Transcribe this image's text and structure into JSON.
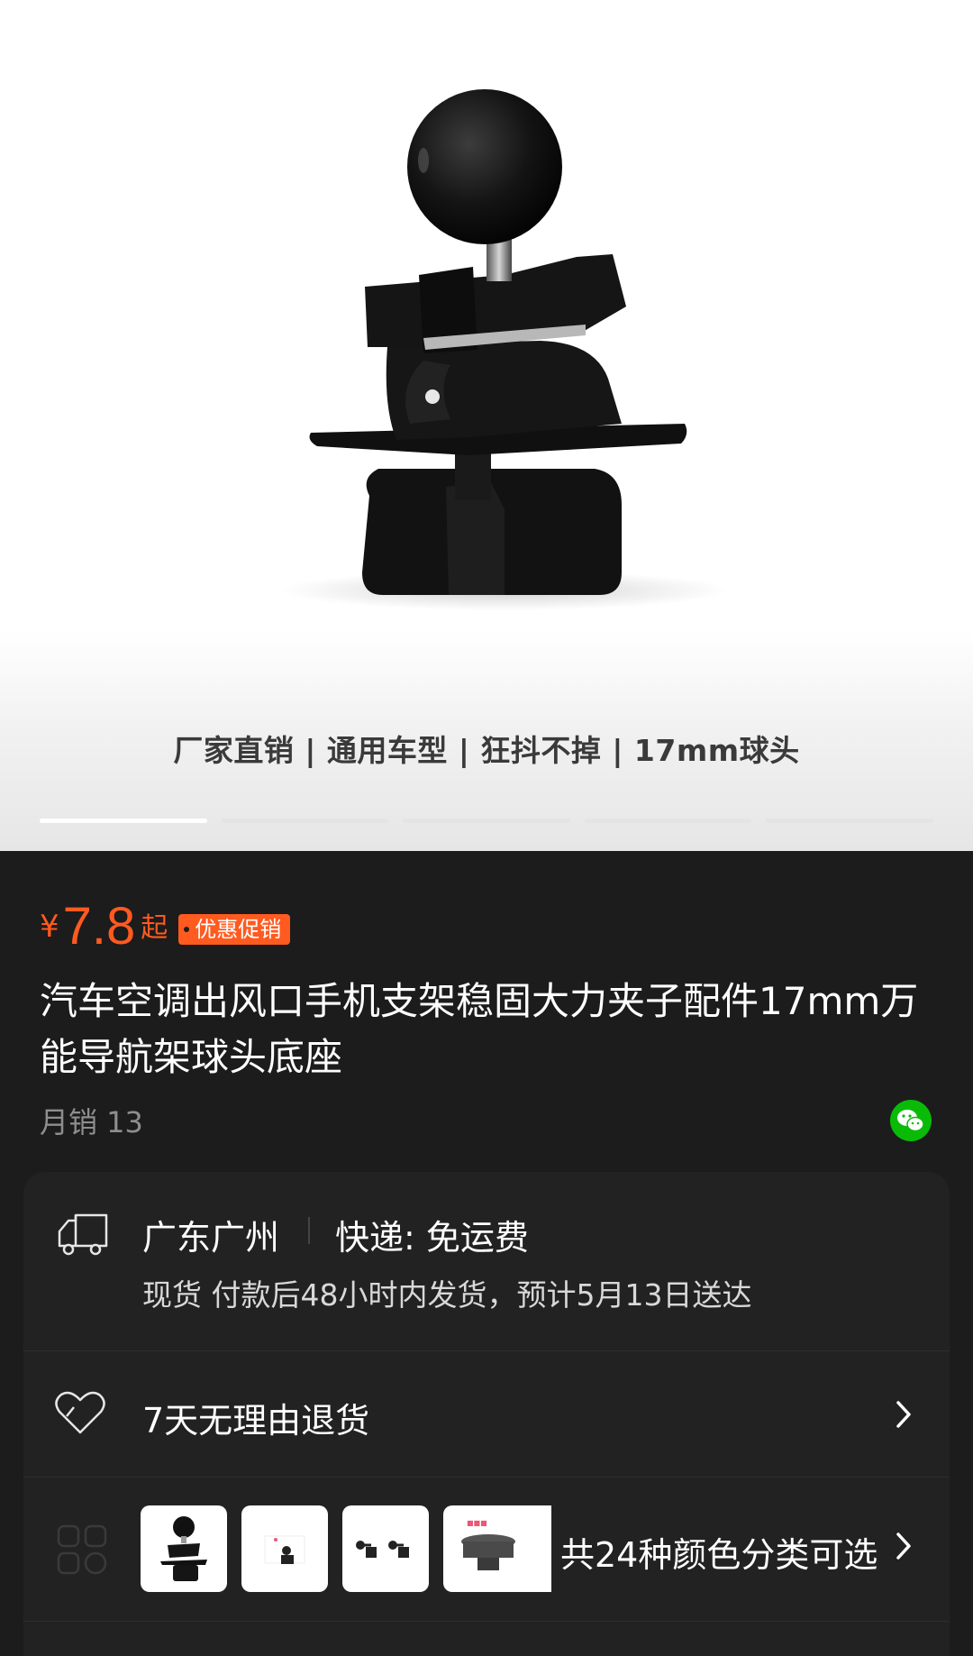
{
  "hero": {
    "tagline": "厂家直销 | 通用车型 | 狂抖不掉 | 17mm球头",
    "slides": [
      {
        "active": true
      },
      {
        "active": false
      },
      {
        "active": false
      },
      {
        "active": false
      },
      {
        "active": false
      }
    ]
  },
  "product": {
    "price_symbol": "¥",
    "price": "7.8",
    "price_suffix": "起",
    "promo_tag": "优惠促销",
    "title": "汽车空调出风口手机支架稳固大力夹子配件17mm万能导航架球头底座",
    "sales": "月销 13",
    "share_icon": "wechat-icon"
  },
  "shipping": {
    "icon": "truck-icon",
    "location": "广东广州",
    "method": "快递: 免运费",
    "detail": "现货 付款后48小时内发货，预计5月13日送达"
  },
  "returns": {
    "icon": "heart-shield-icon",
    "label": "7天无理由退货",
    "chevron": "chevron-right-icon"
  },
  "variants": {
    "icon": "grid-icon",
    "label": "共24种颜色分类可选",
    "chevron": "chevron-right-icon"
  },
  "colors": {
    "price": "#ff5a1f",
    "background": "#1c1c1c",
    "card": "#222222",
    "wechat": "#09bb07"
  }
}
